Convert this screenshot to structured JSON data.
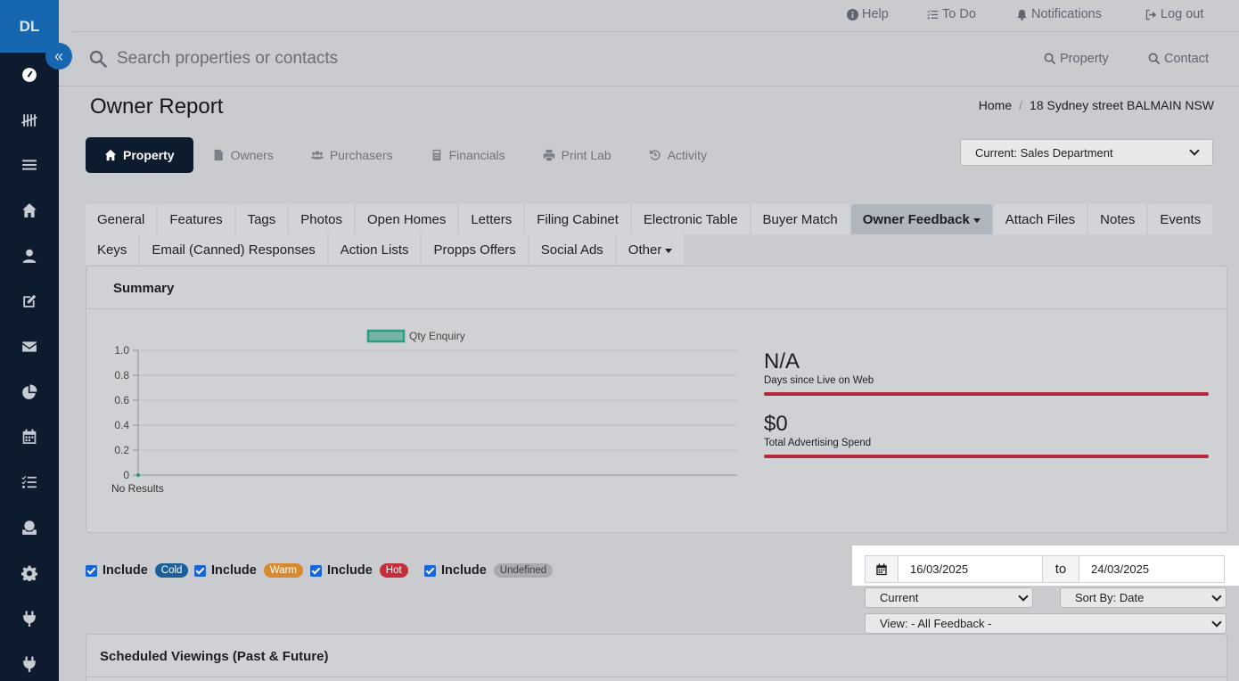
{
  "sidebar": {
    "avatar": "DL",
    "collapse_glyph": "«",
    "items": [
      {
        "icon": "dashboard-icon",
        "active": true
      },
      {
        "icon": "tally-icon"
      },
      {
        "icon": "list-icon"
      },
      {
        "icon": "home-icon"
      },
      {
        "icon": "user-icon"
      },
      {
        "icon": "edit-icon"
      },
      {
        "icon": "mail-icon"
      },
      {
        "icon": "pie-chart-icon"
      },
      {
        "icon": "calendar-icon"
      },
      {
        "icon": "checklist-icon"
      },
      {
        "icon": "inbox-icon"
      },
      {
        "icon": "gear-icon"
      },
      {
        "icon": "plug-icon"
      },
      {
        "icon": "plug-icon"
      }
    ]
  },
  "topnav": {
    "help": "Help",
    "todo": "To Do",
    "notifications": "Notifications",
    "logout": "Log out"
  },
  "search": {
    "placeholder": "Search properties or contacts",
    "property": "Property",
    "contact": "Contact"
  },
  "page": {
    "title": "Owner Report",
    "breadcrumb": {
      "home": "Home",
      "sep": "/",
      "current": "18 Sydney street BALMAIN NSW"
    }
  },
  "primary_tabs": [
    "Property",
    "Owners",
    "Purchasers",
    "Financials",
    "Print Lab",
    "Activity"
  ],
  "department": "Current: Sales Department",
  "secondary_tabs": {
    "row1": [
      "General",
      "Features",
      "Tags",
      "Photos",
      "Open Homes",
      "Letters",
      "Filing Cabinet",
      "Electronic Table",
      "Buyer Match",
      "Owner Feedback",
      "Attach Files",
      "Notes",
      "Events"
    ],
    "row2": [
      "Keys",
      "Email (Canned) Responses",
      "Action Lists",
      "Propps Offers",
      "Social Ads",
      "Other"
    ]
  },
  "summary": {
    "title": "Summary",
    "stats": [
      {
        "value": "N/A",
        "label": "Days since Live on Web"
      },
      {
        "value": "$0",
        "label": "Total Advertising Spend"
      }
    ]
  },
  "chart_data": {
    "type": "line",
    "series": [
      {
        "name": "Qty Enquiry",
        "values": [
          0
        ]
      }
    ],
    "categories": [],
    "yticks": [
      "1.0",
      "0.8",
      "0.6",
      "0.4",
      "0.2",
      "0"
    ],
    "ylim": [
      0,
      1
    ],
    "xlabel": "",
    "ylabel": "",
    "note": "No Results",
    "legend": "top",
    "colors": {
      "series": "#2e9c82"
    }
  },
  "filters": {
    "include_label": "Include",
    "items": [
      {
        "badge": "Cold",
        "color": "#1a5f9a"
      },
      {
        "badge": "Warm",
        "color": "#d98a2e"
      },
      {
        "badge": "Hot",
        "color": "#c62d3b"
      },
      {
        "badge": "Undefined",
        "color": "#a8acb1"
      }
    ]
  },
  "dates": {
    "from": "16/03/2025",
    "to_label": "to",
    "to": "24/03/2025"
  },
  "selects": {
    "status": "Current",
    "sort": "Sort By: Date",
    "view": "View: - All Feedback -"
  },
  "viewings": {
    "title": "Scheduled Viewings (Past & Future)"
  }
}
